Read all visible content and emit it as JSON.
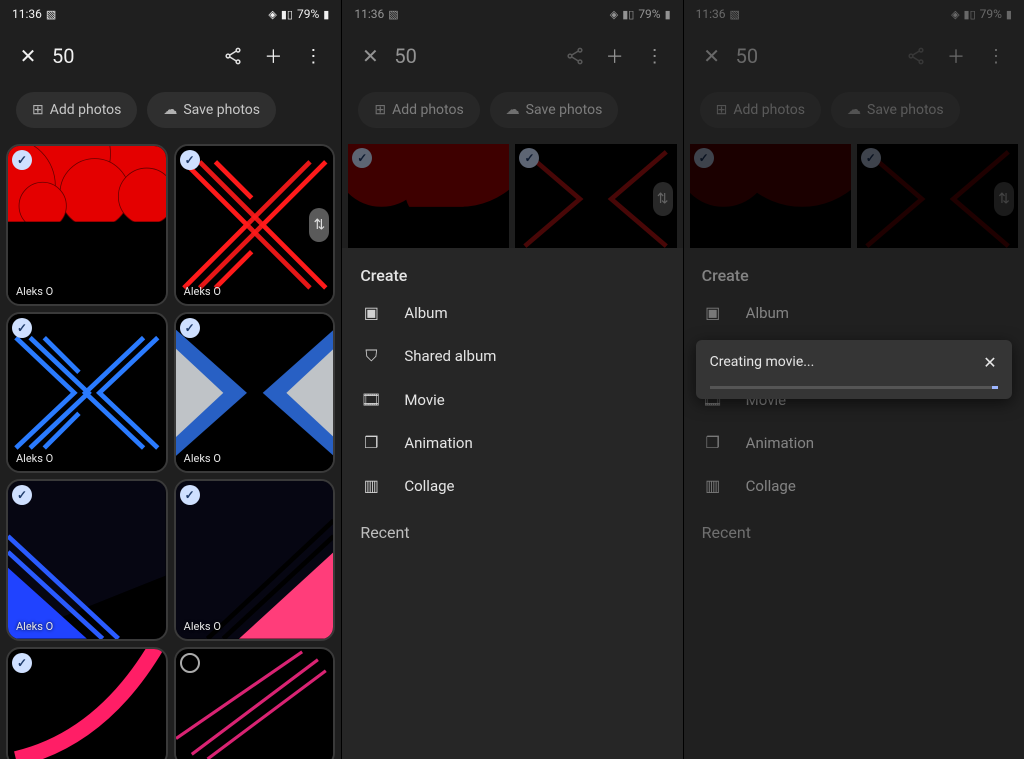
{
  "status": {
    "time": "11:36",
    "battery": "79%"
  },
  "appbar": {
    "title": "50"
  },
  "chips": {
    "add": "Add photos",
    "save": "Save photos"
  },
  "author": "Aleks O",
  "sheet": {
    "heading": "Create",
    "items": {
      "album": "Album",
      "shared": "Shared album",
      "movie": "Movie",
      "animation": "Animation",
      "collage": "Collage"
    },
    "recent": "Recent"
  },
  "snackbar": {
    "message": "Creating movie..."
  }
}
